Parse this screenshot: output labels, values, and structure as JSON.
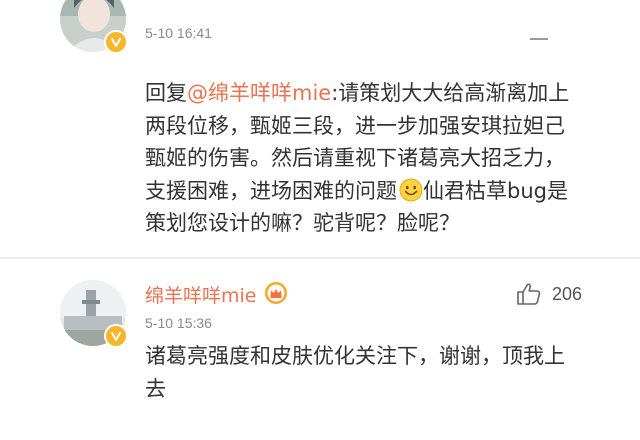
{
  "comments": [
    {
      "timestamp": "5-10 16:41",
      "reply_prefix": "回复",
      "mention": "@绵羊咩咩mie",
      "body": ":请策划大大给高渐离加上两段位移，甄姬三段，进一步加强安琪拉妲己甄姬的伤害。然后请重视下诸葛亮大招乏力，支援困难，进场困难的问题",
      "emoji": "smile-emoji",
      "body_after_emoji": "仙君枯草bug是策划您设计的嘛？驼背呢？脸呢？"
    },
    {
      "username": "绵羊咩咩mie",
      "badge": "crown-badge-icon",
      "timestamp": "5-10 15:36",
      "likes": "206",
      "body": "诸葛亮强度和皮肤优化关注下，谢谢，顶我上去"
    }
  ],
  "colors": {
    "accent": "#eb7350",
    "text": "#333333",
    "meta": "#8a8a8a",
    "verified": "#f8b62b",
    "divider": "#ececec"
  }
}
